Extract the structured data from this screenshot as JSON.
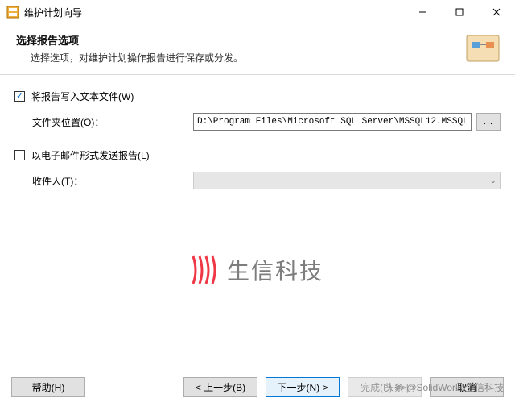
{
  "titlebar": {
    "title": "维护计划向导"
  },
  "header": {
    "title": "选择报告选项",
    "subtitle": "选择选项，对维护计划操作报告进行保存或分发。"
  },
  "options": {
    "write_report": {
      "checked": true,
      "label": "将报告写入文本文件(W)"
    },
    "folder": {
      "label": "文件夹位置(O)：",
      "value": "D:\\Program Files\\Microsoft SQL Server\\MSSQL12.MSSQL",
      "browse": "..."
    },
    "email_report": {
      "checked": false,
      "label": "以电子邮件形式发送报告(L)"
    },
    "recipient": {
      "label": "收件人(T)："
    }
  },
  "watermark": {
    "text": "生信科技"
  },
  "footer": {
    "help": "帮助(H)",
    "back": "< 上一步(B)",
    "next": "下一步(N) >",
    "finish": "完成(F) >>|",
    "cancel": "取消"
  },
  "attribution": "头条 @SolidWorks生信科技"
}
